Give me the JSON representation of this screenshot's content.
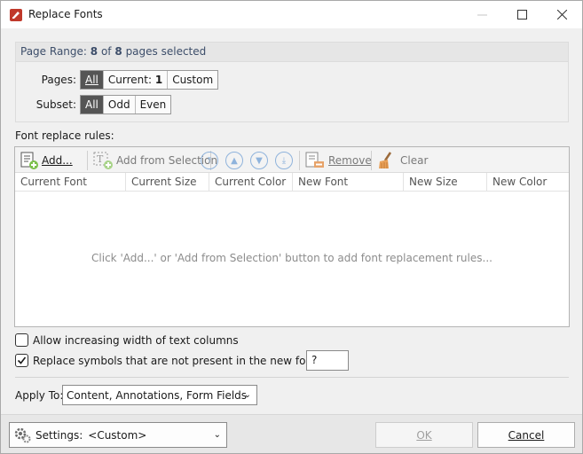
{
  "window": {
    "title": "Replace Fonts"
  },
  "page_range": {
    "header_prefix": "Page Range:",
    "selected_count": "8",
    "of_text": "of",
    "total_count": "8",
    "suffix": "pages selected",
    "pages_label": "Pages:",
    "pages_options": [
      "All",
      "Current: 1",
      "Custom"
    ],
    "pages_selected": "All",
    "subset_label": "Subset:",
    "subset_options": [
      "All",
      "Odd",
      "Even"
    ],
    "subset_selected": "All"
  },
  "rules": {
    "section_label": "Font replace rules:",
    "toolbar": {
      "add": "Add...",
      "add_from_selection": "Add from Selection",
      "remove": "Remove",
      "clear": "Clear"
    },
    "columns": [
      "Current Font",
      "Current Size",
      "Current Color",
      "New Font",
      "New Size",
      "New Color"
    ],
    "empty_message": "Click 'Add...' or 'Add from Selection' button to add font replacement rules..."
  },
  "options": {
    "allow_width": {
      "label": "Allow increasing width of text columns",
      "checked": false
    },
    "replace_symbols": {
      "label": "Replace symbols that are not present in the new font with:",
      "checked": true,
      "value": "?"
    }
  },
  "apply_to": {
    "label": "Apply To:",
    "value": "Content, Annotations, Form Fields"
  },
  "footer": {
    "settings_label": "Settings:",
    "settings_value": "<Custom>",
    "ok": "OK",
    "cancel": "Cancel"
  },
  "colors": {
    "selected_segment": "#555555",
    "arrow_icons": "#8fb3dc",
    "app_icon": "#c0392b"
  }
}
